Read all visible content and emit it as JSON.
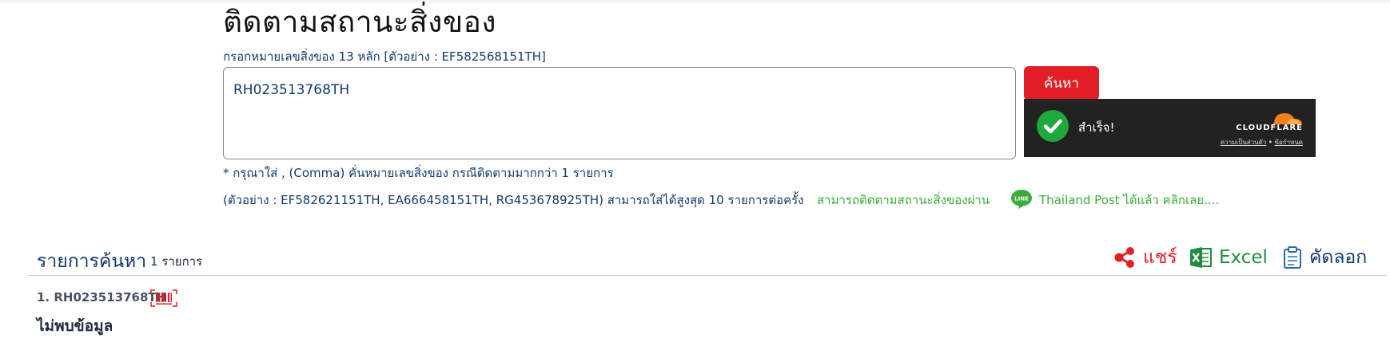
{
  "page": {
    "title": "ติดตามสถานะสิ่งของ",
    "hint": "กรอกหมายเลขสิ่งของ 13 หลัก [ตัวอย่าง : EF582568151TH]"
  },
  "search": {
    "value": "RH023513768TH",
    "button_label": "ค้นหา"
  },
  "captcha": {
    "status": "สำเร็จ!",
    "brand": "CLOUDFLARE",
    "privacy_link": "ความเป็นส่วนตัว",
    "separator": "•",
    "terms_link": "ข้อกำหนด",
    "brand_color": "#f38020",
    "success_color": "#1fa83b"
  },
  "notes": {
    "line1": "* กรุณาใส่ , (Comma) คั่นหมายเลขสิ่งของ กรณีติดตามมากกว่า 1 รายการ",
    "line2": "(ตัวอย่าง : EF582621151TH, EA666458151TH, RG453678925TH) สามารถใส่ได้สูงสุด 10 รายการต่อครั้ง",
    "line_promo_before": "สามารถติดตามสถานะสิ่งของผ่าน",
    "line_icon_text": "LINE",
    "line_promo_after": "Thailand Post ได้แล้ว คลิกเลย...."
  },
  "results": {
    "title": "รายการค้นหา",
    "count": "1 รายการ",
    "share_label": "แชร์",
    "excel_label": "Excel",
    "copy_label": "คัดลอก",
    "item": {
      "id": "1. RH023513768TH",
      "status": "ไม่พบข้อมูล"
    }
  },
  "colors": {
    "accent_red": "#e21f26",
    "excel_green": "#1e8e3e",
    "line_green": "#3aad3a",
    "navy": "#123a6e"
  }
}
